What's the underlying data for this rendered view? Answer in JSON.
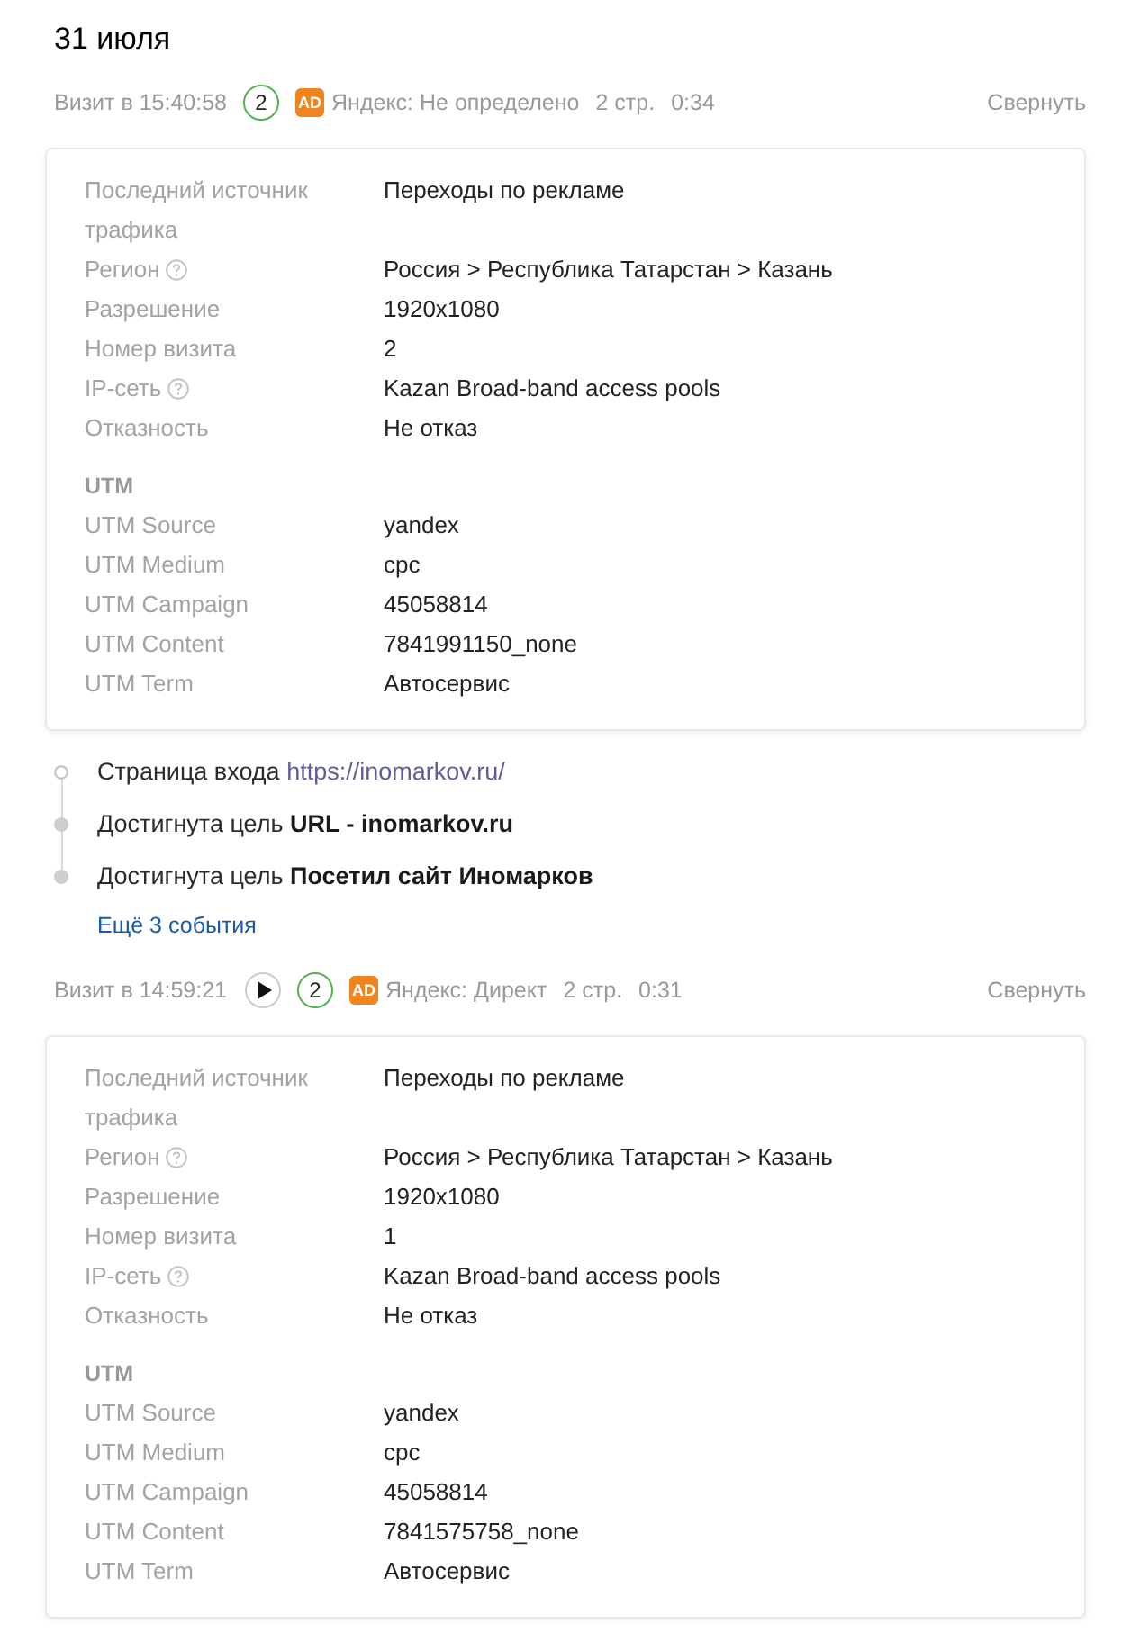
{
  "date": "31 июля",
  "visits": [
    {
      "time": "Визит в 15:40:58",
      "has_recording": false,
      "count_badge": "2",
      "ad_badge": "AD",
      "source": "Яндекс: Не определено",
      "pages": "2 стр.",
      "duration": "0:34",
      "collapse": "Свернуть",
      "details": [
        {
          "label": "Последний источник трафика",
          "value": "Переходы по рекламе",
          "help": false
        },
        {
          "label": "Регион",
          "value": "Россия > Республика Татарстан > Казань",
          "help": true
        },
        {
          "label": "Разрешение",
          "value": "1920x1080",
          "help": false
        },
        {
          "label": "Номер визита",
          "value": "2",
          "help": false
        },
        {
          "label": "IP-сеть",
          "value": "Kazan Broad-band access pools",
          "help": true
        },
        {
          "label": "Отказность",
          "value": "Не отказ",
          "help": false
        }
      ],
      "utm_title": "UTM",
      "utm": [
        {
          "label": "UTM Source",
          "value": "yandex"
        },
        {
          "label": "UTM Medium",
          "value": "cpc"
        },
        {
          "label": "UTM Campaign",
          "value": "45058814"
        },
        {
          "label": "UTM Content",
          "value": "7841991150_none"
        },
        {
          "label": "UTM Term",
          "value": "Автосервис"
        }
      ],
      "events": [
        {
          "kind": "entry",
          "text": "Страница входа",
          "link": "https://inomarkov.ru/"
        },
        {
          "kind": "goal",
          "text": "Достигнута цель **URL - inomarkov.ru**"
        },
        {
          "kind": "goal",
          "text": "Достигнута цель **Посетил сайт Иномарков**"
        }
      ],
      "more_events": "Ещё 3 события"
    },
    {
      "time": "Визит в 14:59:21",
      "has_recording": true,
      "count_badge": "2",
      "ad_badge": "AD",
      "source": "Яндекс: Директ",
      "pages": "2 стр.",
      "duration": "0:31",
      "collapse": "Свернуть",
      "details": [
        {
          "label": "Последний источник трафика",
          "value": "Переходы по рекламе",
          "help": false
        },
        {
          "label": "Регион",
          "value": "Россия > Республика Татарстан > Казань",
          "help": true
        },
        {
          "label": "Разрешение",
          "value": "1920x1080",
          "help": false
        },
        {
          "label": "Номер визита",
          "value": "1",
          "help": false
        },
        {
          "label": "IP-сеть",
          "value": "Kazan Broad-band access pools",
          "help": true
        },
        {
          "label": "Отказность",
          "value": "Не отказ",
          "help": false
        }
      ],
      "utm_title": "UTM",
      "utm": [
        {
          "label": "UTM Source",
          "value": "yandex"
        },
        {
          "label": "UTM Medium",
          "value": "cpc"
        },
        {
          "label": "UTM Campaign",
          "value": "45058814"
        },
        {
          "label": "UTM Content",
          "value": "7841575758_none"
        },
        {
          "label": "UTM Term",
          "value": "Автосервис"
        }
      ]
    }
  ]
}
